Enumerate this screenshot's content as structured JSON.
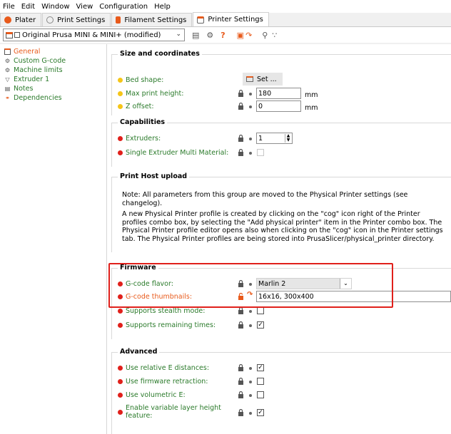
{
  "menu": {
    "items": [
      "File",
      "Edit",
      "Window",
      "View",
      "Configuration",
      "Help"
    ]
  },
  "tabs": [
    {
      "label": "Plater",
      "icon": "plater-icon",
      "color": "#e85a1b"
    },
    {
      "label": "Print Settings",
      "icon": "gear-icon",
      "color": "#888888"
    },
    {
      "label": "Filament Settings",
      "icon": "spool-icon",
      "color": "#e85a1b"
    },
    {
      "label": "Printer Settings",
      "icon": "printer-icon",
      "color": "#888888"
    }
  ],
  "toolbar": {
    "preset": "Original Prusa MINI & MINI+ (modified)"
  },
  "sidebar": {
    "items": [
      {
        "label": "General",
        "icon": "printer-icon"
      },
      {
        "label": "Custom G-code",
        "icon": "gear-icon"
      },
      {
        "label": "Machine limits",
        "icon": "gear-icon"
      },
      {
        "label": "Extruder 1",
        "icon": "funnel-icon"
      },
      {
        "label": "Notes",
        "icon": "notes-icon"
      },
      {
        "label": "Dependencies",
        "icon": "link-icon"
      }
    ]
  },
  "size": {
    "title": "Size and coordinates",
    "bed_shape_label": "Bed shape:",
    "bed_shape_button": "Set ...",
    "max_height_label": "Max print height:",
    "max_height_value": "180",
    "max_height_unit": "mm",
    "z_offset_label": "Z offset:",
    "z_offset_value": "0",
    "z_offset_unit": "mm"
  },
  "capabilities": {
    "title": "Capabilities",
    "extruders_label": "Extruders:",
    "extruders_value": "1",
    "semm_label": "Single Extruder Multi Material:"
  },
  "host": {
    "title": "Print Host upload",
    "note1": "Note: All parameters from this group are moved to the Physical Printer settings (see changelog).",
    "note2": "A new Physical Printer profile is created by clicking on the \"cog\" icon right of the Printer profiles combo box, by selecting the \"Add physical printer\" item in the Printer combo box. The Physical Printer profile editor opens also when clicking on the \"cog\" icon in the Printer settings tab. The Physical Printer profiles are being stored into PrusaSlicer/physical_printer directory."
  },
  "firmware": {
    "title": "Firmware",
    "flavor_label": "G-code flavor:",
    "flavor_value": "Marlin 2",
    "thumbs_label": "G-code thumbnails:",
    "thumbs_value": "16x16, 300x400",
    "stealth_label": "Supports stealth mode:",
    "remaining_label": "Supports remaining times:"
  },
  "advanced": {
    "title": "Advanced",
    "rel_e_label": "Use relative E distances:",
    "fw_retract_label": "Use firmware retraction:",
    "vol_e_label": "Use volumetric E:",
    "var_layer_label_1": "Enable variable layer height",
    "var_layer_label_2": "feature:"
  },
  "colors": {
    "accent": "#e85a1b",
    "label_green": "#2a7a2a",
    "highlight_red": "#e0201b"
  }
}
